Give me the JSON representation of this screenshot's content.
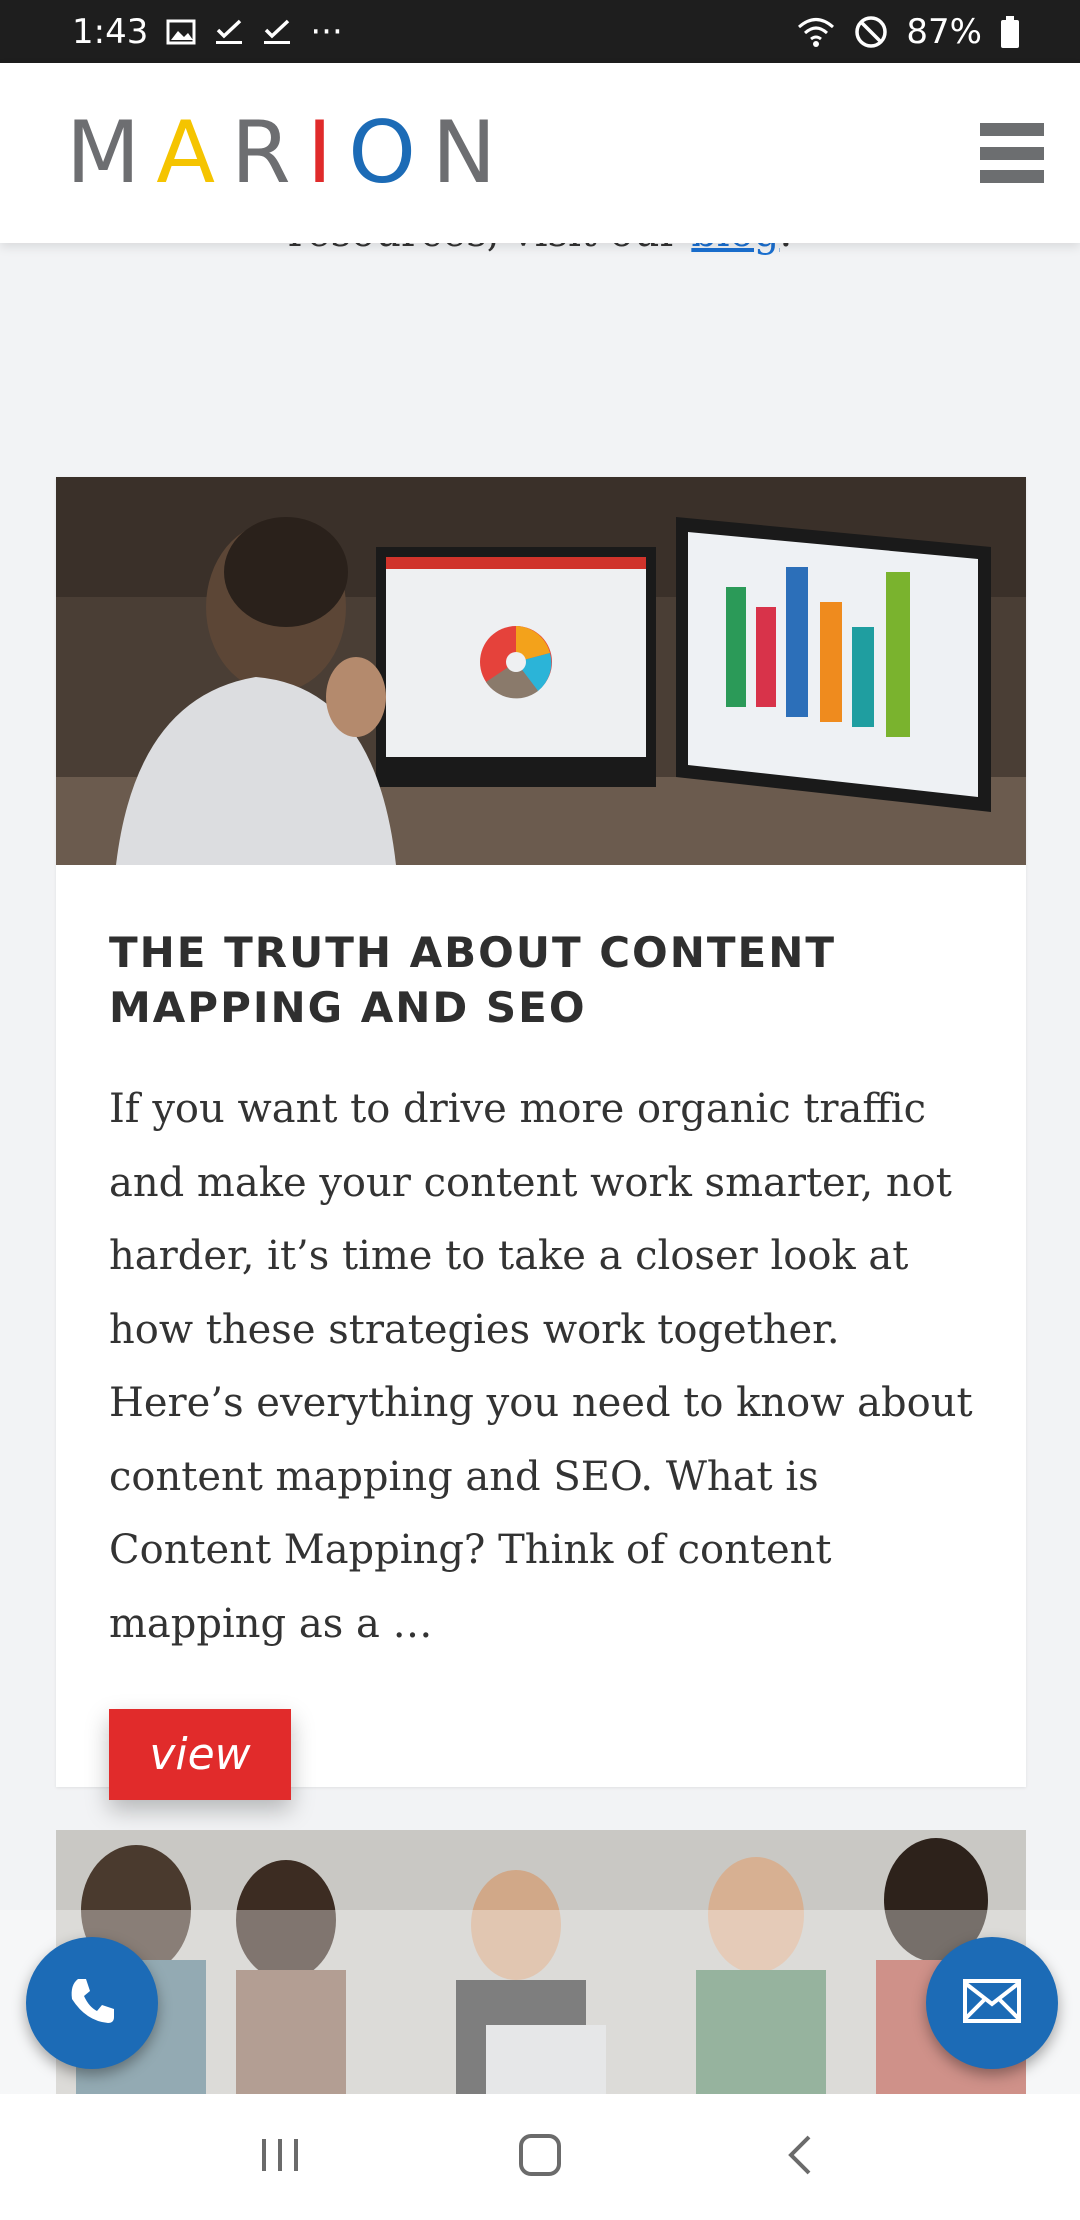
{
  "status_bar": {
    "time": "1:43",
    "ellipsis": "···",
    "battery": "87%"
  },
  "header": {
    "logo_letters": [
      "M",
      "A",
      "R",
      "I",
      "O",
      "N"
    ],
    "logo_colors": [
      "#6d6e71",
      "#f5c400",
      "#6d6e71",
      "#e02b2b",
      "#1c6bb6",
      "#6d6e71"
    ]
  },
  "partial_text": {
    "prefix": "resources, visit our ",
    "link": "blog",
    "suffix": "."
  },
  "card": {
    "title": "THE TRUTH ABOUT CONTENT MAPPING AND SEO",
    "excerpt": "If you want to drive more organic traffic and make your content work smarter, not harder, it’s time to take a closer look at how these strategies work together. Here’s everything you need to know about content mapping and SEO. What is Content Mapping? Think of content mapping as a …",
    "button_label": "view"
  },
  "colors": {
    "accent_red": "#e12b2b",
    "accent_blue": "#1c6bb6"
  }
}
